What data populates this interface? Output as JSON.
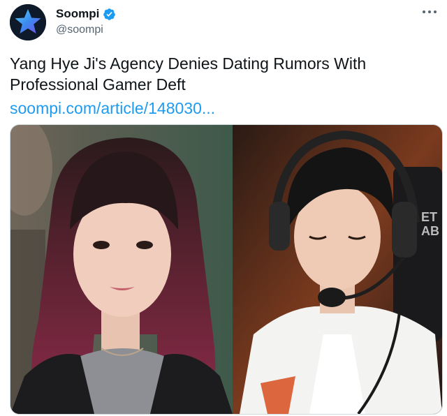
{
  "tweet": {
    "display_name": "Soompi",
    "handle": "@soompi",
    "text": "Yang Hye Ji's Agency Denies Dating Rumors With Professional Gamer Deft",
    "link": "soompi.com/article/148030..."
  },
  "icons": {
    "avatar": "star-logo-icon",
    "verified": "verified-badge-icon",
    "more": "more-options-icon"
  },
  "media": {
    "left_photo": "actress-photo",
    "right_photo": "gamer-photo"
  },
  "colors": {
    "link": "#1d9bf0",
    "verified": "#1d9bf0",
    "secondary_text": "#536471"
  }
}
